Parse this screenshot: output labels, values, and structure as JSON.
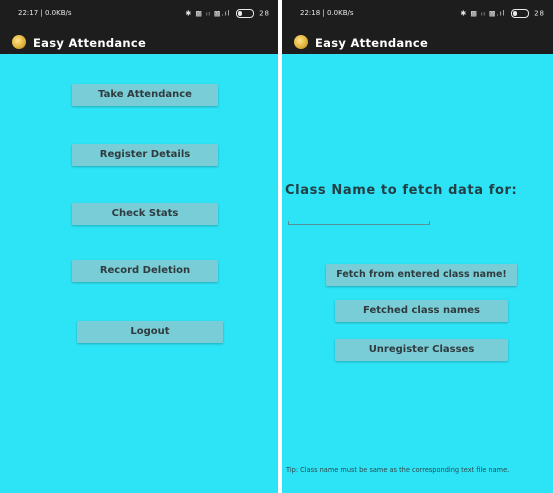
{
  "left_screen": {
    "status_bar": {
      "time_speed": "22:17 | 0.0KB/s",
      "indicators": "✱ ▩ ᵢₗ ▩.ıl",
      "battery": "28"
    },
    "app_bar": {
      "title": "Easy Attendance",
      "logo_icon": "app-logo-icon"
    },
    "buttons": {
      "take_attendance": "Take Attendance",
      "register_details": "Register Details",
      "check_stats": "Check Stats",
      "record_deletion": "Record Deletion",
      "logout": "Logout"
    }
  },
  "right_screen": {
    "status_bar": {
      "time_speed": "22:18 | 0.0KB/s",
      "indicators": "✱ ▩ ᵢₗ ▩.ıl",
      "battery": "28"
    },
    "app_bar": {
      "title": "Easy Attendance",
      "logo_icon": "app-logo-icon"
    },
    "class_name_label": "Class Name to fetch data for:",
    "class_name_input": {
      "value": "",
      "placeholder": ""
    },
    "buttons": {
      "fetch_entered": "Fetch from entered class name!",
      "fetched_names": "Fetched class names",
      "unregister": "Unregister Classes"
    },
    "tip": "Tip: Class name must be same as the corresponding text file name."
  },
  "colors": {
    "screen_background": "#2de4f6",
    "button_background": "#79cdd6",
    "app_bar_background": "#1d1d1d",
    "button_text": "#2f3b3f"
  }
}
